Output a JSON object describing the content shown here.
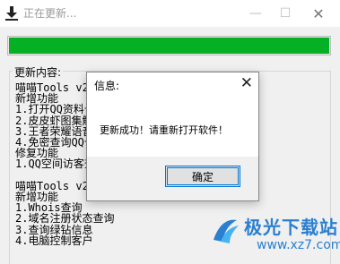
{
  "window": {
    "title": "正在更新...",
    "minimize": "—",
    "maximize": "☐",
    "close": "✕"
  },
  "progress": {
    "value": 1.0,
    "color": "#06b025"
  },
  "content": {
    "legend": "更新内容:",
    "lines": [
      "喵喵Tools v2.",
      "新增功能",
      "1.打开QQ资料卡",
      "2.皮皮虾图集解",
      "3.王者荣耀语音",
      "4.免密查询QQ卡",
      "修复功能",
      "1.QQ空间访客查",
      "",
      "喵喵Tools v2.",
      "新增功能",
      "1.Whois查询",
      "2.域名注册状态查询",
      "3.查询绿钻信息",
      "4.电脑控制客户"
    ]
  },
  "dialog": {
    "title": "信息:",
    "close": "✕",
    "message": "更新成功！请重新打开软件！",
    "ok_label": "确定"
  },
  "watermark": {
    "text": "极光下载站",
    "url": "www.xz7.com"
  }
}
